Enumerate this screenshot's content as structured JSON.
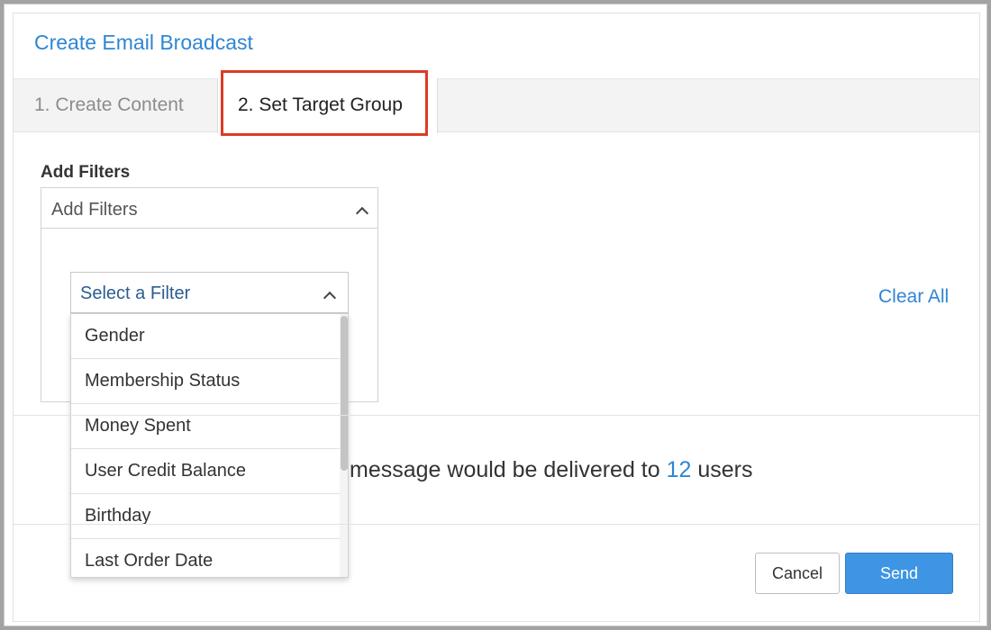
{
  "dialog": {
    "title": "Create Email Broadcast"
  },
  "tabs": [
    {
      "label": "1. Create Content"
    },
    {
      "label": "2. Set Target Group"
    }
  ],
  "filters": {
    "section_label": "Add Filters",
    "header_label": "Add Filters",
    "select_placeholder": "Select a Filter",
    "options": [
      "Gender",
      "Membership Status",
      "Money Spent",
      "User Credit Balance",
      "Birthday",
      "Last Order Date"
    ],
    "clear_all_label": "Clear All"
  },
  "delivery": {
    "text_prefix": "message would be delivered to",
    "count": "12",
    "text_suffix": "users"
  },
  "footer": {
    "cancel_label": "Cancel",
    "send_label": "Send"
  },
  "colors": {
    "accent": "#2f86d4",
    "send": "#3d95e3",
    "highlight": "#dc3b26"
  },
  "icons": {
    "header_chevron": "chevron-up-icon",
    "select_chevron": "chevron-up-icon"
  }
}
